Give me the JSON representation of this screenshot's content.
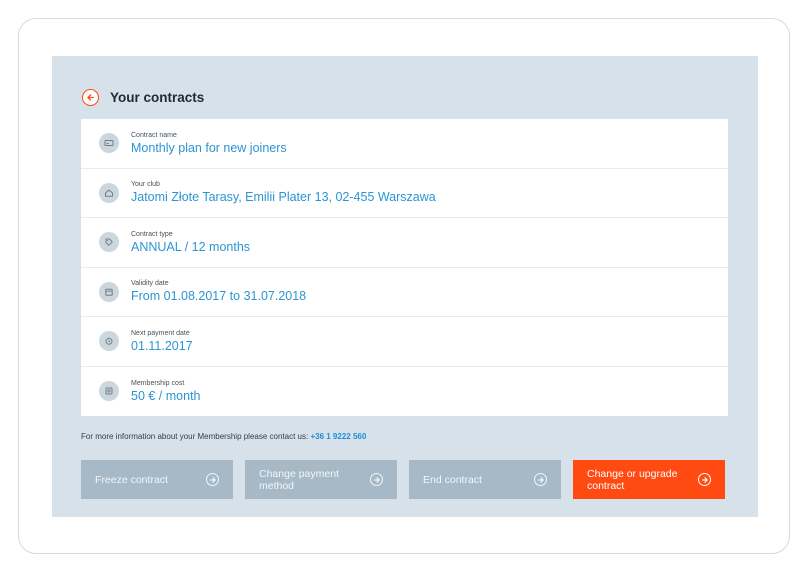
{
  "header": {
    "title": "Your contracts"
  },
  "rows": [
    {
      "label": "Contract name",
      "value": "Monthly plan for new joiners",
      "icon": "card-icon"
    },
    {
      "label": "Your club",
      "value": "Jatomi Złote Tarasy, Emilii Plater 13, 02-455 Warszawa",
      "icon": "home-icon"
    },
    {
      "label": "Contract type",
      "value": "ANNUAL / 12 months",
      "icon": "tag-icon"
    },
    {
      "label": "Validity date",
      "value": "From 01.08.2017 to 31.07.2018",
      "icon": "calendar-icon"
    },
    {
      "label": "Next payment date",
      "value": "01.11.2017",
      "icon": "clock-icon"
    },
    {
      "label": "Membership cost",
      "value": "50 € / month",
      "icon": "money-icon"
    }
  ],
  "info": {
    "text": "For more information about your Membership please contact us: ",
    "phone": "+36 1 9222 560"
  },
  "buttons": {
    "freeze": "Freeze contract",
    "change_payment": "Change payment method",
    "end": "End contract",
    "upgrade": "Change or upgrade contract"
  },
  "colors": {
    "accent": "#ff4a12",
    "link": "#2b95d3",
    "panel": "#d6e1e9",
    "button_disabled": "#a7b9c6"
  }
}
